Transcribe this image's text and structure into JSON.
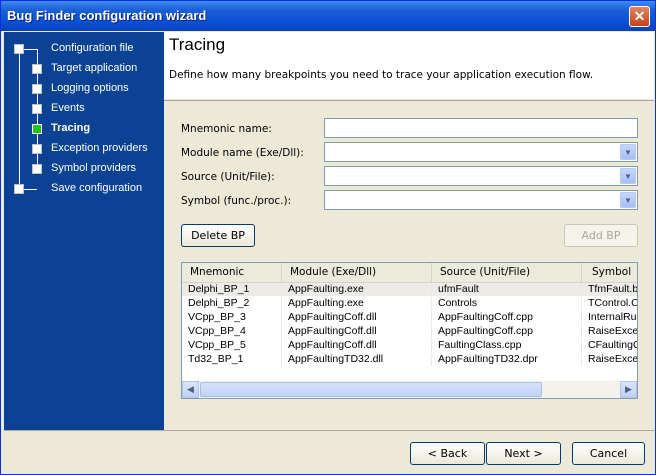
{
  "window": {
    "title": "Bug Finder configuration wizard",
    "close_glyph": "✕"
  },
  "steps": [
    {
      "label": "Configuration file",
      "active": false
    },
    {
      "label": "Target application",
      "active": false
    },
    {
      "label": "Logging options",
      "active": false
    },
    {
      "label": "Events",
      "active": false
    },
    {
      "label": "Tracing",
      "active": true
    },
    {
      "label": "Exception providers",
      "active": false
    },
    {
      "label": "Symbol providers",
      "active": false
    },
    {
      "label": "Save configuration",
      "active": false
    }
  ],
  "page": {
    "title": "Tracing",
    "description": "Define how many breakpoints you need to trace your application execution flow."
  },
  "form": {
    "mnemonic_label": "Mnemonic name:",
    "mnemonic_value": "",
    "module_label": "Module name (Exe/Dll):",
    "module_value": "",
    "source_label": "Source (Unit/File):",
    "source_value": "",
    "symbol_label": "Symbol (func./proc.):",
    "symbol_value": ""
  },
  "buttons": {
    "delete_bp": "Delete BP",
    "add_bp": "Add BP",
    "back": "< Back",
    "next": "Next >",
    "cancel": "Cancel"
  },
  "table": {
    "columns": [
      "Mnemonic",
      "Module (Exe/Dll)",
      "Source (Unit/File)",
      "Symbol"
    ],
    "rows": [
      [
        "Delphi_BP_1",
        "AppFaulting.exe",
        "ufmFault",
        "TfmFault.b"
      ],
      [
        "Delphi_BP_2",
        "AppFaulting.exe",
        "Controls",
        "TControl.C"
      ],
      [
        "VCpp_BP_3",
        "AppFaultingCoff.dll",
        "AppFaultingCoff.cpp",
        "InternalRu"
      ],
      [
        "VCpp_BP_4",
        "AppFaultingCoff.dll",
        "AppFaultingCoff.cpp",
        "RaiseExce"
      ],
      [
        "VCpp_BP_5",
        "AppFaultingCoff.dll",
        "FaultingClass.cpp",
        "CFaultingC"
      ],
      [
        "Td32_BP_1",
        "AppFaultingTD32.dll",
        "AppFaultingTD32.dpr",
        "RaiseExce"
      ]
    ]
  },
  "colors": {
    "sidebar": "#0b4294",
    "active_step": "#22c31a",
    "titlebar": "#0a4fd6"
  },
  "icons": {
    "dropdown": "chevron-down-icon",
    "scroll_left": "arrow-left-icon",
    "scroll_right": "arrow-right-icon"
  }
}
